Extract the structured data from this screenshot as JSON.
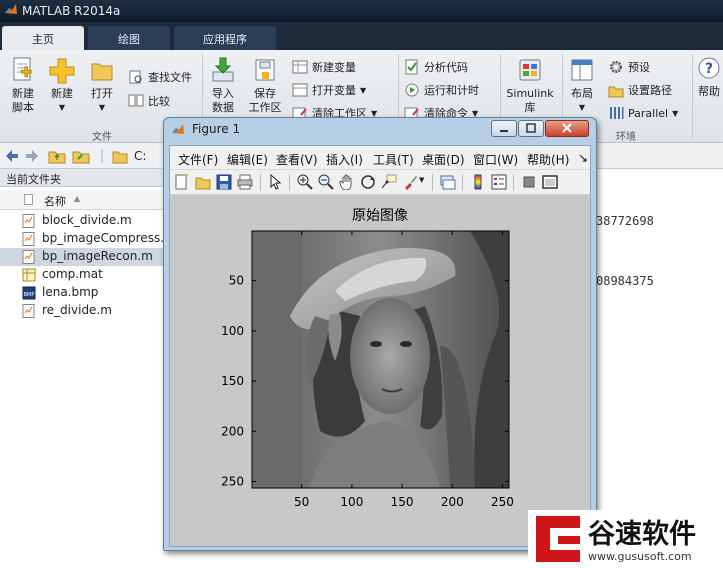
{
  "window": {
    "title": "MATLAB R2014a"
  },
  "tabs": [
    {
      "label": "主页"
    },
    {
      "label": "绘图"
    },
    {
      "label": "应用程序"
    }
  ],
  "ribbon": {
    "new_script": "新建\n脚本",
    "new": "新建",
    "open": "打开",
    "find_files": "查找文件",
    "compare": "比较",
    "import_data": "导入\n数据",
    "save_workspace": "保存\n工作区",
    "new_variable": "新建变量",
    "open_variable": "打开变量",
    "clear_workspace": "清除工作区",
    "analyze_code": "分析代码",
    "run_and_time": "运行和计时",
    "clear_commands": "清除命令",
    "simulink": "Simulink\n库",
    "layout": "布局",
    "preferences": "预设",
    "set_path": "设置路径",
    "parallel": "Parallel",
    "help": "帮助",
    "section_file": "文件",
    "section_env": "环境"
  },
  "address": {
    "path": "C:"
  },
  "current_folder": {
    "title": "当前文件夹",
    "column_name": "名称",
    "files": [
      {
        "name": "block_divide.m",
        "type": "m"
      },
      {
        "name": "bp_imageCompress.m",
        "type": "m"
      },
      {
        "name": "bp_imageRecon.m",
        "type": "m",
        "selected": true
      },
      {
        "name": "comp.mat",
        "type": "mat"
      },
      {
        "name": "lena.bmp",
        "type": "bmp"
      },
      {
        "name": "re_divide.m",
        "type": "m"
      }
    ]
  },
  "command_window": {
    "line1": "38772698",
    "line2": "08984375"
  },
  "figure": {
    "title": "Figure 1",
    "menu": [
      "文件(F)",
      "编辑(E)",
      "查看(V)",
      "插入(I)",
      "工具(T)",
      "桌面(D)",
      "窗口(W)",
      "帮助(H)"
    ],
    "more": "↘"
  },
  "chart_data": {
    "type": "image",
    "title": "原始图像",
    "xticks": [
      "50",
      "100",
      "150",
      "200",
      "250"
    ],
    "yticks": [
      "50",
      "100",
      "150",
      "200",
      "250"
    ],
    "xlim": [
      0.5,
      256.5
    ],
    "ylim": [
      0.5,
      256.5
    ],
    "colormap": "gray"
  },
  "watermark": {
    "brand": "谷速软件",
    "url": "www.gususoft.com"
  }
}
